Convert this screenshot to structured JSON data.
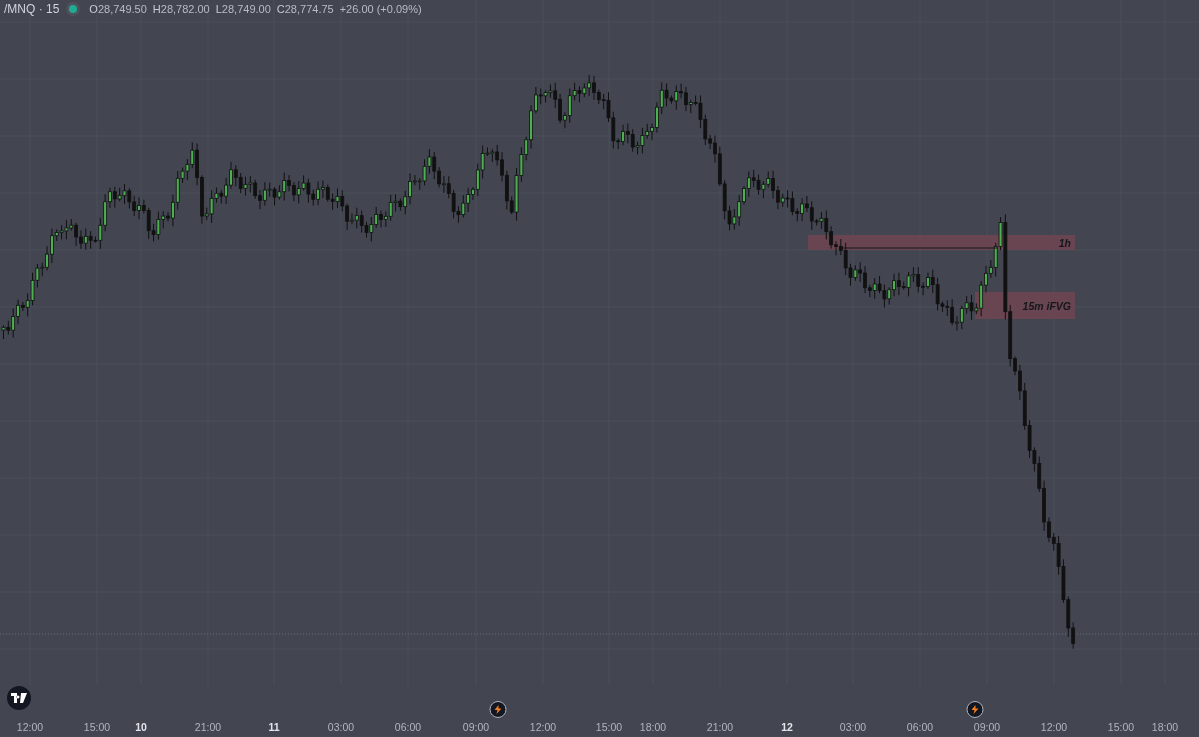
{
  "header": {
    "symbol": "/MNQ · 15",
    "ohlc": [
      {
        "label": "O",
        "value": "28,749.50"
      },
      {
        "label": "H",
        "value": "28,782.00"
      },
      {
        "label": "L",
        "value": "28,749.00"
      },
      {
        "label": "C",
        "value": "28,774.75"
      }
    ],
    "change": "+26.00 (+0.09%)"
  },
  "zones": [
    {
      "label": "1h"
    },
    {
      "label": "15m iFVG"
    }
  ],
  "time_axis": [
    {
      "label": "12:00",
      "kind": "time"
    },
    {
      "label": "15:00",
      "kind": "time"
    },
    {
      "label": "10",
      "kind": "day"
    },
    {
      "label": "21:00",
      "kind": "time"
    },
    {
      "label": "11",
      "kind": "day"
    },
    {
      "label": "03:00",
      "kind": "time"
    },
    {
      "label": "06:00",
      "kind": "time"
    },
    {
      "label": "09:00",
      "kind": "time"
    },
    {
      "label": "12:00",
      "kind": "time"
    },
    {
      "label": "15:00",
      "kind": "time"
    },
    {
      "label": "18:00",
      "kind": "time"
    },
    {
      "label": "21:00",
      "kind": "time"
    },
    {
      "label": "12",
      "kind": "day"
    },
    {
      "label": "03:00",
      "kind": "time"
    },
    {
      "label": "06:00",
      "kind": "time"
    },
    {
      "label": "09:00",
      "kind": "time"
    },
    {
      "label": "12:00",
      "kind": "time"
    },
    {
      "label": "15:00",
      "kind": "time"
    },
    {
      "label": "18:00",
      "kind": "time"
    }
  ]
}
